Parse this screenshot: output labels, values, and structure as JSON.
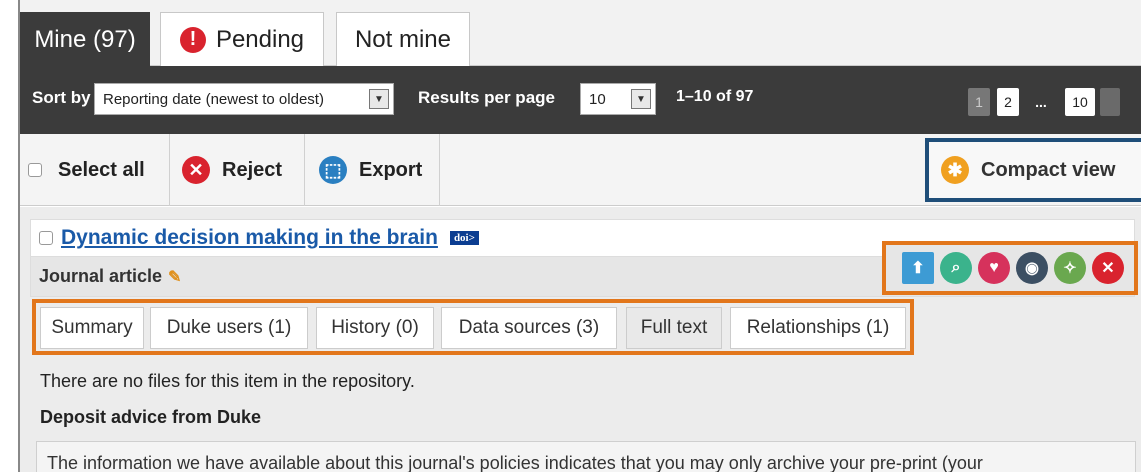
{
  "tabs": {
    "mine": "Mine (97)",
    "pending": "Pending",
    "not_mine": "Not mine"
  },
  "sortbar": {
    "sort_label": "Sort by",
    "sort_value": "Reporting date (newest to oldest)",
    "rpp_label": "Results per page",
    "rpp_value": "10",
    "range": "1–10 of 97",
    "pages": [
      "1",
      "2",
      "...",
      "10"
    ]
  },
  "actions": {
    "select_all": "Select all",
    "reject": "Reject",
    "export": "Export",
    "compact_view": "Compact view"
  },
  "item": {
    "title": "Dynamic decision making in the brain",
    "doi": "doi>",
    "type": "Journal article",
    "subtabs": [
      "Summary",
      "Duke users (1)",
      "History (0)",
      "Data sources (3)",
      "Full text",
      "Relationships (1)"
    ],
    "no_files": "There are no files for this item in the repository.",
    "advice_heading": "Deposit advice from Duke",
    "advice_text": "The information we have available about this journal's policies indicates that you may only archive your pre-print (your"
  },
  "colors": {
    "dark_bar": "#3b3b3b",
    "link": "#1a5aa8",
    "highlight_orange": "#e2761b",
    "highlight_blue": "#1f4e79",
    "reject_red": "#d9232e",
    "export_blue": "#2a7fc1",
    "compact_orange": "#f0a020"
  },
  "icons": [
    "upload-icon",
    "search-icon",
    "heart-icon",
    "eye-icon",
    "privacy-icon",
    "close-icon"
  ]
}
